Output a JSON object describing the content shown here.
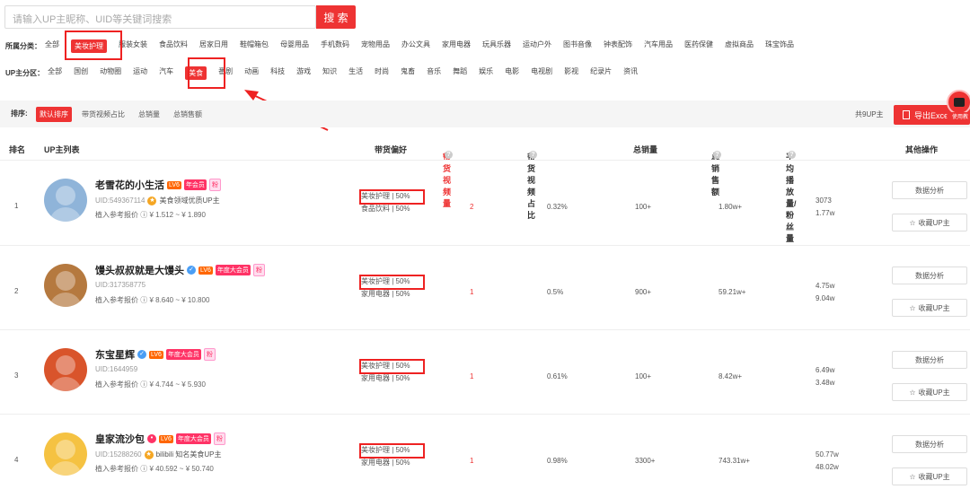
{
  "search": {
    "placeholder": "请输入UP主昵称、UID等关键词搜索",
    "button": "搜 索"
  },
  "category_row": {
    "label": "所属分类：",
    "items": [
      "全部",
      "美妆护理",
      "服装女装",
      "食品饮料",
      "居家日用",
      "鞋帽箱包",
      "母婴用品",
      "手机数码",
      "宠物用品",
      "办公文具",
      "家用电器",
      "玩具乐器",
      "运动户外",
      "图书音像",
      "钟表配饰",
      "汽车用品",
      "医药保健",
      "虚拟商品",
      "珠宝饰品"
    ],
    "active_index": 1
  },
  "partition_row": {
    "label": "UP主分区：",
    "items": [
      "全部",
      "国创",
      "动物圈",
      "运动",
      "汽车",
      "美食",
      "番剧",
      "动画",
      "科技",
      "游戏",
      "知识",
      "生活",
      "时尚",
      "鬼畜",
      "音乐",
      "舞蹈",
      "娱乐",
      "电影",
      "电视剧",
      "影视",
      "纪录片",
      "资讯"
    ],
    "active_index": 5
  },
  "sortbar": {
    "label": "排序:",
    "options": [
      "默认排序",
      "带货视频占比",
      "总销量",
      "总销售额"
    ],
    "total": "共9UP主",
    "export": "导出Excel",
    "badge": "使用教"
  },
  "table": {
    "headers": {
      "rank": "排名",
      "list": "UP主列表",
      "pref": "带货偏好",
      "videos": "带货视频量",
      "ratio": "带货视频占比",
      "sales": "总销量",
      "revenue": "总销售额",
      "avg": "平均播放量/粉丝量",
      "ops": "其他操作"
    },
    "action_analyze": "数据分析",
    "action_collect": "收藏UP主",
    "rows": [
      {
        "rank": "1",
        "name": "老雪花的小生活",
        "lv": "LV6",
        "vip": "年会员",
        "fan": "粉",
        "uid": "UID:549367114",
        "desc": "美食领域优质UP主",
        "price": "植入参考报价 ⓘ ¥ 1.512 ~ ¥ 1.890",
        "pref1": "美妆护理 | 50%",
        "pref2": "食品饮料 | 50%",
        "videos": "2",
        "ratio": "0.32%",
        "sales": "100+",
        "revenue": "1.80w+",
        "avg_play": "3073",
        "fans": "1.77w",
        "avatar_color": "#8fb4d9"
      },
      {
        "rank": "2",
        "name": "馒头叔叔就是大馒头",
        "lv": "LV6",
        "vip": "年度大会员",
        "fan": "粉",
        "uid": "UID:317358775",
        "desc": "",
        "price": "植入参考报价 ⓘ ¥ 8.640 ~ ¥ 10.800",
        "pref1": "美妆护理 | 50%",
        "pref2": "家用电器 | 50%",
        "videos": "1",
        "ratio": "0.5%",
        "sales": "900+",
        "revenue": "59.21w+",
        "avg_play": "4.75w",
        "fans": "9.04w",
        "avatar_color": "#b5793f"
      },
      {
        "rank": "3",
        "name": "东宝星辉",
        "lv": "LV6",
        "vip": "年度大会员",
        "fan": "粉",
        "uid": "UID:1644959",
        "desc": "",
        "price": "植入参考报价 ⓘ ¥ 4.744 ~ ¥ 5.930",
        "pref1": "美妆护理 | 50%",
        "pref2": "家用电器 | 50%",
        "videos": "1",
        "ratio": "0.61%",
        "sales": "100+",
        "revenue": "8.42w+",
        "avg_play": "6.49w",
        "fans": "3.48w",
        "avatar_color": "#d9542b"
      },
      {
        "rank": "4",
        "name": "皇家流沙包",
        "lv": "LV6",
        "vip": "年度大会员",
        "fan": "粉",
        "uid": "UID:15288260",
        "desc": "bilibili 知名美食UP主",
        "price": "植入参考报价 ⓘ ¥ 40.592 ~ ¥ 50.740",
        "pref1": "美妆护理 | 50%",
        "pref2": "家用电器 | 50%",
        "videos": "1",
        "ratio": "0.98%",
        "sales": "3300+",
        "revenue": "743.31w+",
        "avg_play": "50.77w",
        "fans": "48.02w",
        "avatar_color": "#f5c242"
      }
    ]
  },
  "colors": {
    "accent": "#e33",
    "annotation": "#e22"
  }
}
